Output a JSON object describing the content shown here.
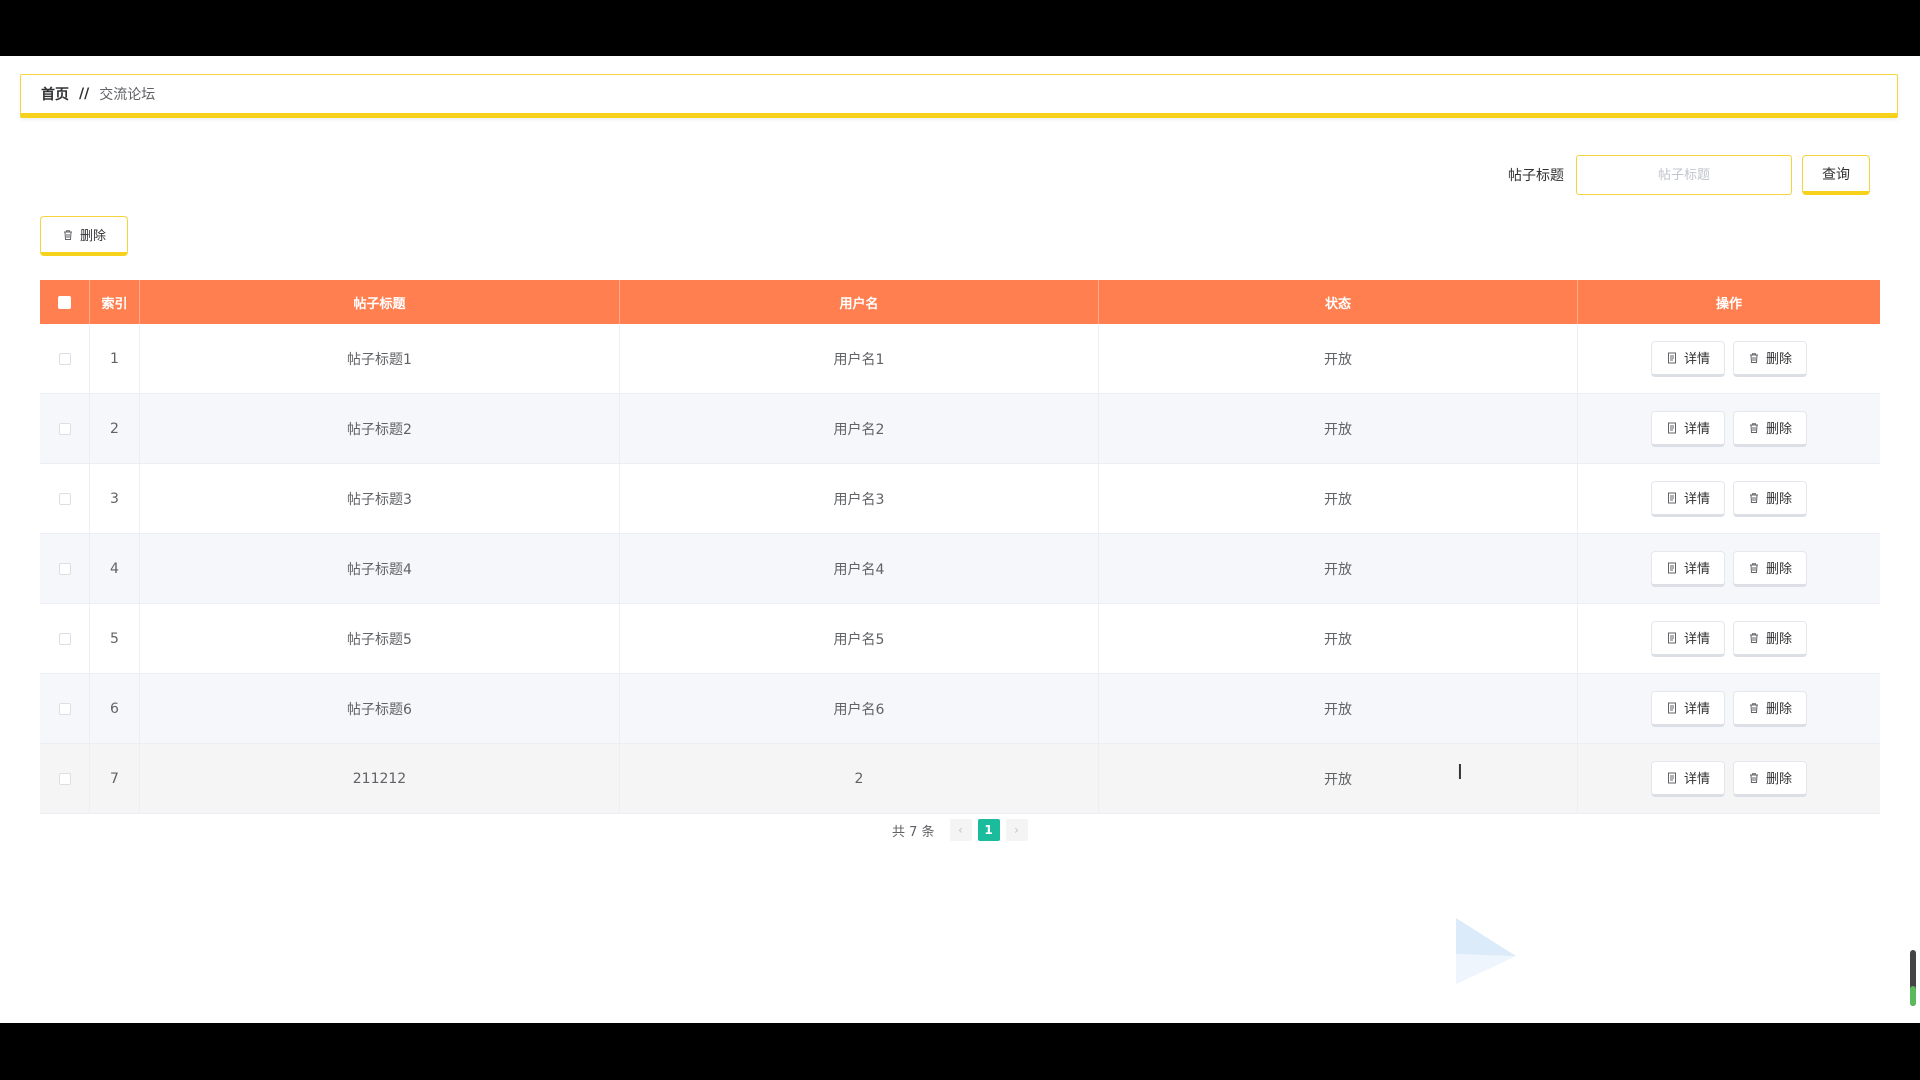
{
  "breadcrumb": {
    "home": "首页",
    "separator": "//",
    "current": "交流论坛"
  },
  "search": {
    "label": "帖子标题",
    "placeholder": "帖子标题",
    "query_button": "查询"
  },
  "toolbar": {
    "delete_label": "删除"
  },
  "table": {
    "headers": {
      "index": "索引",
      "title": "帖子标题",
      "username": "用户名",
      "status": "状态",
      "ops": "操作"
    },
    "rows": [
      {
        "index": "1",
        "title": "帖子标题1",
        "username": "用户名1",
        "status": "开放"
      },
      {
        "index": "2",
        "title": "帖子标题2",
        "username": "用户名2",
        "status": "开放"
      },
      {
        "index": "3",
        "title": "帖子标题3",
        "username": "用户名3",
        "status": "开放"
      },
      {
        "index": "4",
        "title": "帖子标题4",
        "username": "用户名4",
        "status": "开放"
      },
      {
        "index": "5",
        "title": "帖子标题5",
        "username": "用户名5",
        "status": "开放"
      },
      {
        "index": "6",
        "title": "帖子标题6",
        "username": "用户名6",
        "status": "开放"
      },
      {
        "index": "7",
        "title": "211212",
        "username": "2",
        "status": "开放"
      }
    ],
    "detail_label": "详情",
    "delete_label": "删除"
  },
  "pagination": {
    "total": "共 7 条",
    "current_page": "1",
    "prev": "‹",
    "next": "›"
  },
  "icons": {
    "cursor": "text-cursor-icon",
    "doc": "document-icon",
    "trash": "trash-icon",
    "watermark": "play-logo-icon"
  },
  "colors": {
    "accent": "#f7d21c",
    "header": "#ff7f50",
    "page_active": "#1abc9c"
  }
}
